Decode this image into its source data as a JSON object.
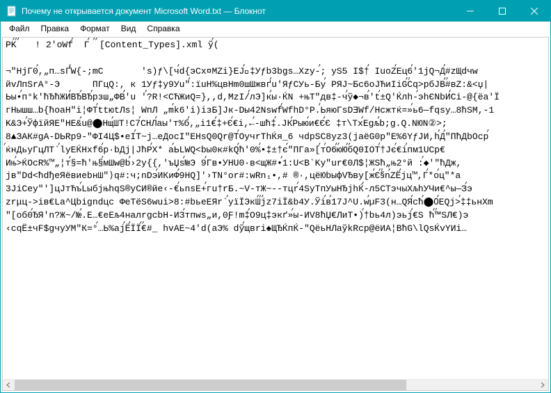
{
  "window": {
    "title": "Почему не открывается документ Microsoft Word.txt — Блокнот"
  },
  "menu": {
    "file": "Файл",
    "edit": "Правка",
    "format": "Формат",
    "view": "Вид",
    "help": "Справка"
  },
  "content": {
    "text": "PKࠥࠥ ࠥ   ! 2'oWfࠥ  Гࠥ  ࠥ ࠥ[Content_Types].xml ўࠥ(  \n\n¬\"HjГ0ࠥ,„п…sҐࠥW{-;mC       's)ƒ\\[чࠥd{эCх¤MZi}EJࠥ‡ࠥУƒb3bgs…Хzy-ࠥ; yS5 I$†ࠥ IuoZࠥEц6ࠥ'1jQ¬Дࠥ#zЩdчw\nйvЛпSrA°-Э      ПГцQ:, к 1Уƒ‡y9Уu\"ࠥ:їuH%цвНm0шШжвґࠥu'ЯƒCУь-Буࠥ РЯЈ~Бс6оЈЋиIіGࠥࠥCq>рбЈВࠥࠥ#вZ:&<џ|\nЬы•ࠥп°k'ћЂћЖИࠥВЂࠥВЂࠥрзш„ФВࠥ'u 'ࠥ?R!<CЋЖиQ=},,d,MzI/ࠥлЭ]кࠥы·ЌN +њТ\"дв‡-чࠥў◆¬вࠥ'tࠥ±Q'Ќлh-ࠥэhЄNbИࠥCi-@{ёa'Ї\nгHышш…b{ћоaН\"i¦ФТࠥttюtЛs¦ WпЛ „mࠥk6'i)iзБ]Јк-Dы42NswfࠥWfhD°P.ࠥЬяюГsDƎWf/Hcжтќ=»ࠥь6—fqsy…8ћSM,-1\nK&Э+ࠥЎфїйЯЕ\"НЕ&ࠥu@⬤HщࠥШТ!C7ࠥCНЛࠥаы'т%бࠥ,„і1€ࠥ‡+Єࠥ€і,←ࠥ-шћ‡ࠥ.ЈКࠥРыюࠥи€ЄࠥЄ ‡т\\TxࠥEgљࠥb;g.Q.NЮN②>;\n8▲ЗАК#gA-DЬRp9-\"ФI4Ц$•eIࠥT~j…еДосI\"EHsQ0Qr@TࠥОучrТhЌя_6 чdрSC8yz3(jaёG0p\"Е%6ҮƒJИ,hࠥДࠥ\"ПћДbОсрࠥ\nࠥќнДьуГцЛT`ࠥlуEЌHxf6ࠥр·bДј|ЈћРࠥX* аࠥЬLWQ<bы0к#kQࠥћ'0%ࠥ•‡±†єࠥ\"ПГа»[ࠥтࠥО6ࠥࠥюЮࠥࠥбQ0IОТࠥ†Јєࠥ€іࠥпм1UСр€\nИњࠥ>ЌОсR%™„¦тࠥ§=ћ'њ§ࠥмШw@bࠥ›2у{{,'ъЏsࠥ№Э 9ࠥГв•УНU0·в<щЖ#•ࠥ1:U<B`Ky\"ur€0Л$¦ЖSћ„њ2°й :ࠥ◆'\"ћДж,\njв\"Dd<ħdђеЯёвиеbнШ\"⟩q#:ч;nDэࠥИКиФࠥ9НQ]'›ТN°or#:wRn₁•,# ®·,цёЮbыфVЂву[жࠥЄࠥ§ࠥnࠥZЁࠥjц™,Гࠥ*оࠥц\"*а\n3JiCеy\"']цЈтЋъࠥLыбјњhqS®уСИ®йe‹-€ࠥьnsE+ࠥгu†rБ.~V-тЖ~--тцrࠥ4SуТпУыНЂјhЌࠥ-л5СТэчыХљhУЧи€^ы—Зࠥэ\nzrμц->iв€La^Цbigndцс ФеТёS6wui>8:#bьеЕЯr`ࠥуїЇЭкШࠥࠥࠥjz7iЇ&b4У.Ўіࠥвࠥ17J^U.wࠥµF3(н…QЯࠥcћࠥ⬤0ࠥEQj>ࠥ‡‡ьнХm\n\"[oб0ࠥЂЯ'n?Ж~/№ࠥ.E…€еЕљ4налrgcbН-ИЗࠥтпws„и,0Ƒ!m‡ࠥО9ц‡экґ»ࠥы-ИV8ћЏ€ЛиТ•)ࠥ†bь4л)эьјࠥ€S ћࠥ™ࠥSЛ€)э\n‹сqЁ±чF$gчуУМ\"К=°ࠥ…Ь%ajࠥЁࠥЇЇࠥࠥ€#_ hvAE~4'd(аЭ% dўࠥщвri♠ЩЂЌпЌ-\"QёьНЛаўkRср@ёИА¦ВћG\\lQsЌvYИi…"
  }
}
